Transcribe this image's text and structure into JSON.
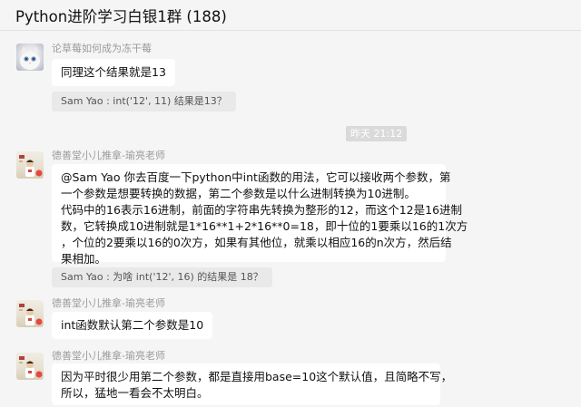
{
  "header": {
    "title": "Python进阶学习白银1群 (188)"
  },
  "messages": {
    "m1": {
      "sender": "论草莓如何成为冻干莓",
      "text": "同理这个结果就是13"
    },
    "q1": {
      "text": "Sam Yao : int('12', 11) 结果是13？"
    },
    "time1": {
      "text": "昨天 21:12"
    },
    "m2": {
      "sender": "德善堂小儿推拿-瑜亮老师",
      "lines": [
        "@Sam Yao 你去百度一下python中int函数的用法，它可以接收两个参数，第",
        "一个参数是想要转换的数据，第二个参数是以什么进制转换为10进制。",
        "代码中的16表示16进制，前面的字符串先转换为整形的12，而这个12是16进制",
        "数，它转换成10进制就是1*16**1+2*16**0=18，即十位的1要乘以16的1次方",
        "，个位的2要乘以16的0次方，如果有其他位，就乘以相应16的n次方，然后结",
        "果相加。"
      ]
    },
    "q2": {
      "text": "Sam Yao : 为啥 int('12', 16) 的结果是 18？"
    },
    "m3": {
      "sender": "德善堂小儿推拿-瑜亮老师",
      "text": "int函数默认第二个参数是10"
    },
    "m4": {
      "sender": "德善堂小儿推拿-瑜亮老师",
      "lines": [
        "因为平时很少用第二个参数，都是直接用base=10这个默认值，且简略不写，",
        "所以，猛地一看会不太明白。"
      ]
    }
  },
  "icons": {
    "cat_avatar": "cat-avatar-icon",
    "teacher_avatar": "teacher-avatar-icon"
  },
  "colors": {
    "background": "#f5f5f5",
    "bubble": "#ffffff",
    "quote": "#e9e9e9",
    "time_badge": "#dadada"
  }
}
